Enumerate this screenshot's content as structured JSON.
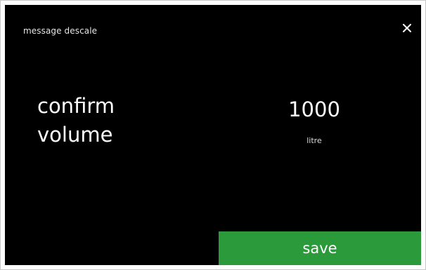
{
  "header": {
    "title": "message descale",
    "close_icon": "close-icon"
  },
  "main": {
    "label_line1": "confirm",
    "label_line2": "volume",
    "value": "1000",
    "unit": "litre"
  },
  "footer": {
    "save_label": "save",
    "save_color": "#2a9a3a"
  }
}
